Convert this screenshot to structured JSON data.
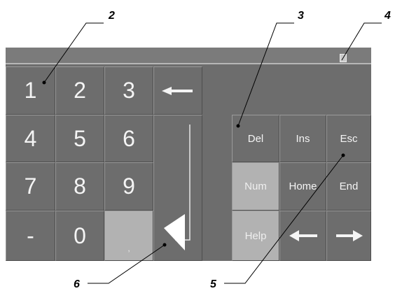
{
  "callouts": [
    "2",
    "3",
    "4",
    "5",
    "6"
  ],
  "numpad": {
    "row1": [
      "1",
      "2",
      "3"
    ],
    "row2": [
      "4",
      "5",
      "6"
    ],
    "row3": [
      "7",
      "8",
      "9"
    ],
    "minus": "-",
    "zero": "0",
    "comma": ","
  },
  "editpad": {
    "del": "Del",
    "ins": "Ins",
    "esc": "Esc",
    "num": "Num",
    "home": "Home",
    "end": "End",
    "help": "Help"
  },
  "colors": {
    "panel": "#6d6d6d",
    "highlight_key": "#b2b2b2",
    "key_text": "#f4f4f4"
  },
  "icons": [
    "backspace-arrow-icon",
    "enter-arrow-icon",
    "left-arrow-icon",
    "right-arrow-icon",
    "close-icon"
  ]
}
